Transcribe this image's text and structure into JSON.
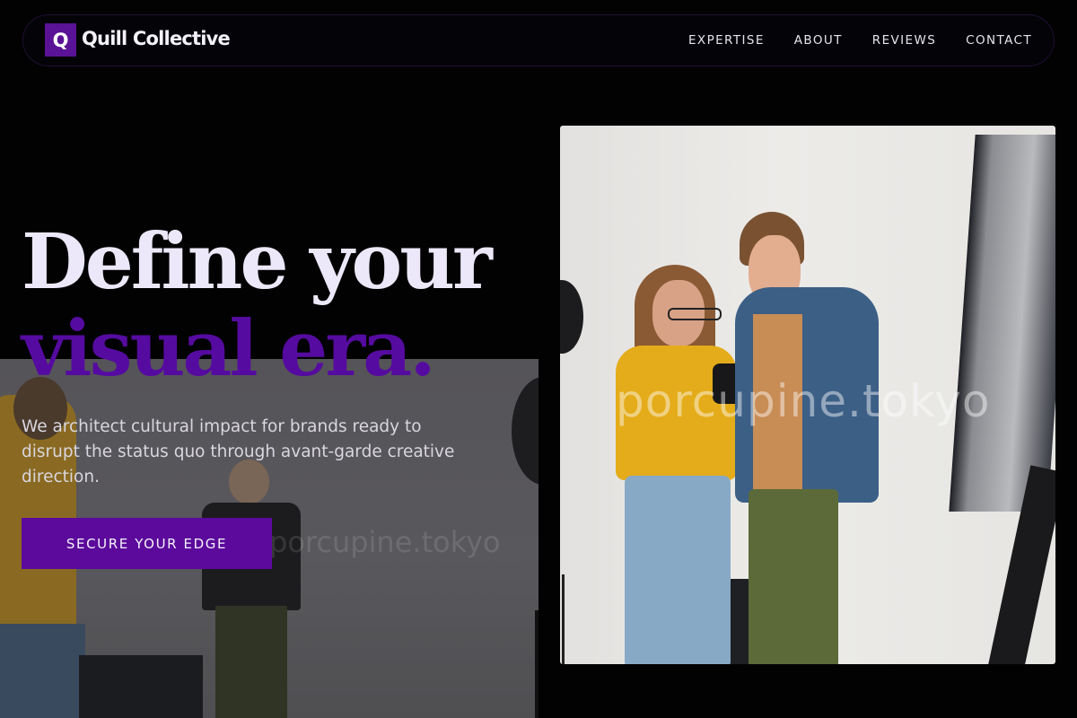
{
  "brand": {
    "logo_letter": "Q",
    "name": "Quill Collective"
  },
  "nav": {
    "items": [
      {
        "label": "EXPERTISE"
      },
      {
        "label": "ABOUT"
      },
      {
        "label": "REVIEWS"
      },
      {
        "label": "CONTACT"
      }
    ]
  },
  "hero": {
    "title_line_1": "Define your",
    "title_line_2": "visual era.",
    "subtitle": "We architect cultural impact for brands ready to disrupt the status quo through avant-garde creative direction.",
    "cta_label": "SECURE YOUR EDGE"
  },
  "watermarks": {
    "left": "porcupine.tokyo",
    "right": "porcupine.tokyo"
  },
  "colors": {
    "accent": "#5b0a9c",
    "background": "#020203",
    "title": "#ece8f9"
  }
}
